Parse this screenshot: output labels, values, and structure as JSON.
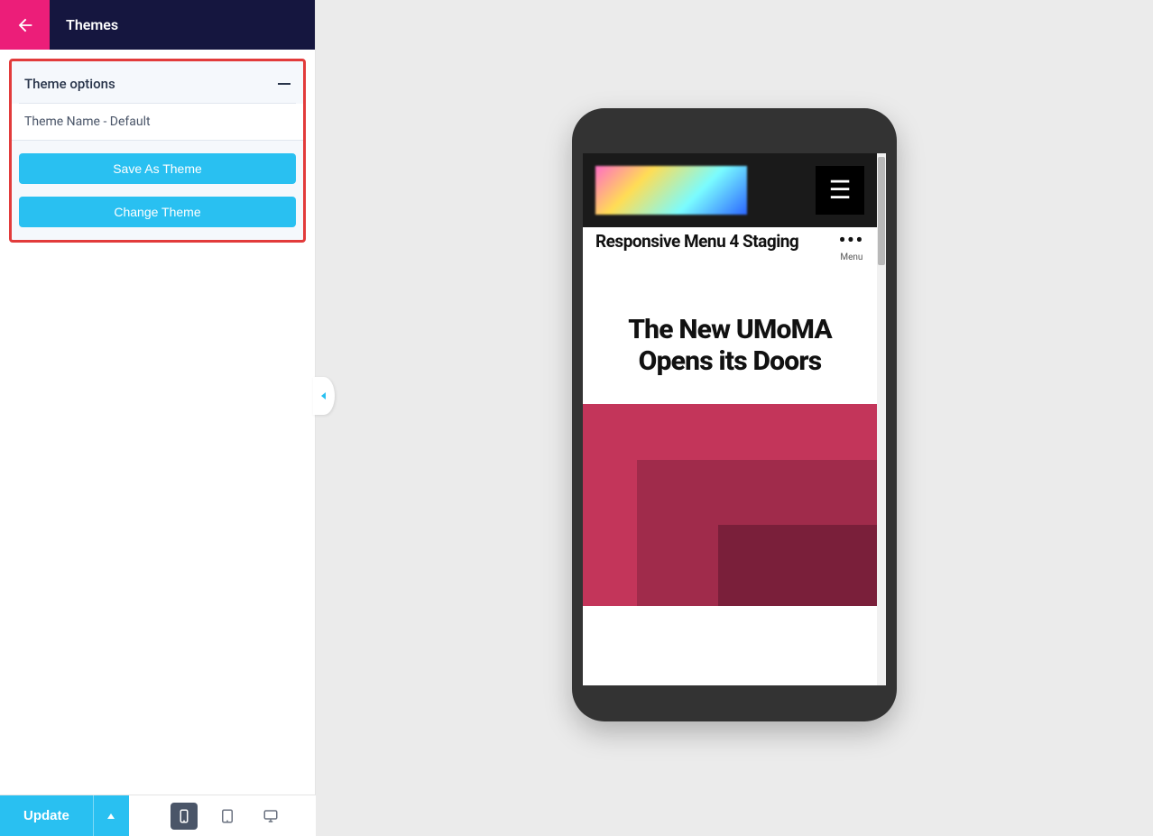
{
  "sidebar": {
    "title": "Themes",
    "panel": {
      "header": "Theme options",
      "theme_name": "Theme Name - Default",
      "save_btn": "Save As Theme",
      "change_btn": "Change Theme"
    }
  },
  "bottom": {
    "update": "Update"
  },
  "preview": {
    "site_title": "Responsive Menu 4 Staging",
    "menu_label": "Menu",
    "hero_heading": "The New UMoMA Opens its Doors"
  }
}
